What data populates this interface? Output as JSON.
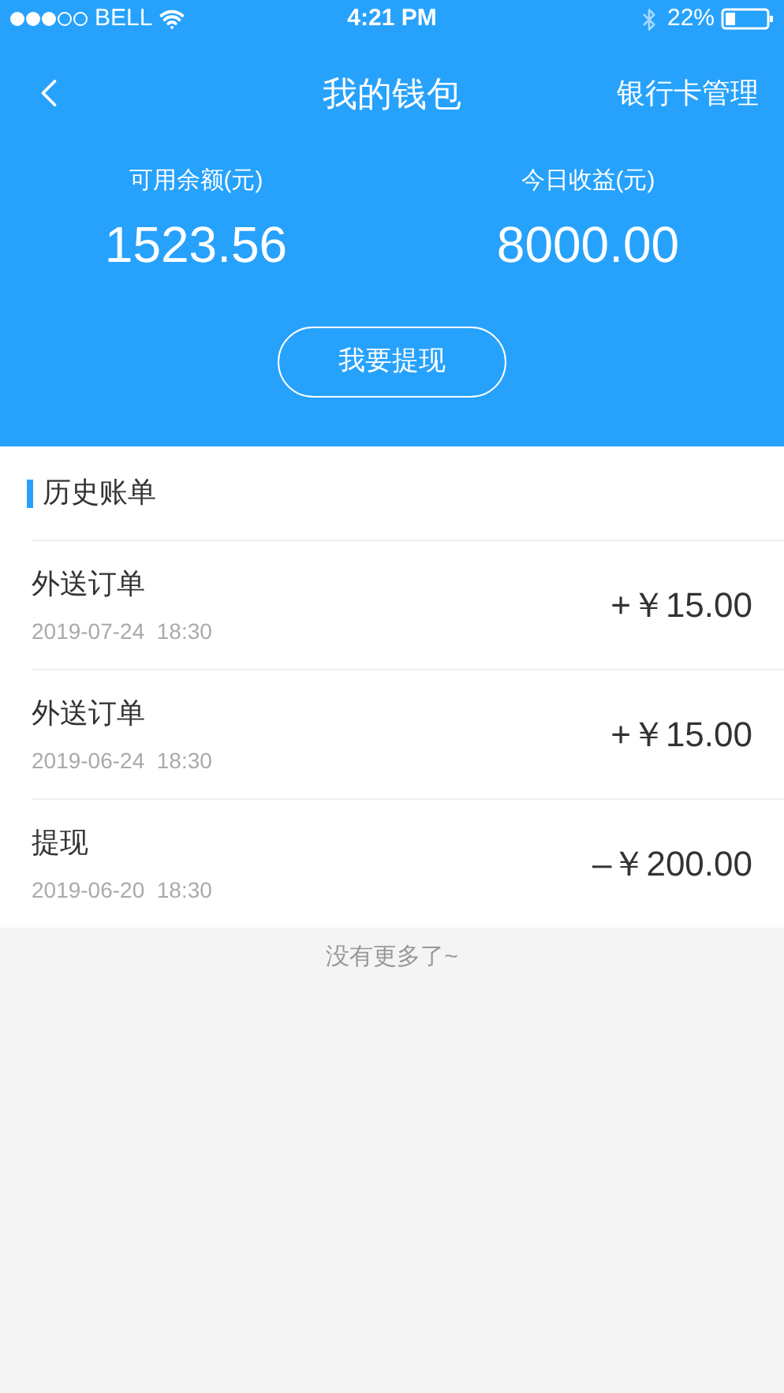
{
  "status_bar": {
    "carrier": "BELL",
    "time": "4:21 PM",
    "battery": "22%"
  },
  "nav": {
    "title": "我的钱包",
    "action": "银行卡管理"
  },
  "balances": [
    {
      "label": "可用余额(元)",
      "value": "1523.56"
    },
    {
      "label": "今日收益(元)",
      "value": "8000.00"
    }
  ],
  "withdraw_button": "我要提现",
  "history": {
    "title": "历史账单",
    "rows": [
      {
        "title": "外送订单",
        "time": "2019-07-24  18:30",
        "amount": "+￥15.00"
      },
      {
        "title": "外送订单",
        "time": "2019-06-24  18:30",
        "amount": "+￥15.00"
      },
      {
        "title": "提现",
        "time": "2019-06-20  18:30",
        "amount": "–￥200.00"
      }
    ]
  },
  "footer": "没有更多了~"
}
